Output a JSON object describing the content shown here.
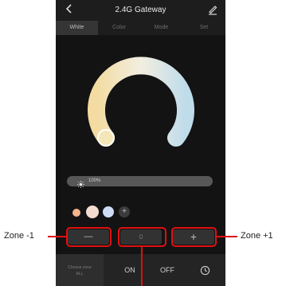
{
  "header": {
    "back_icon": "chevron-left-icon",
    "title": "2.4G Gateway",
    "edit_icon": "pencil-icon"
  },
  "tabs": [
    {
      "label": "White",
      "active": true
    },
    {
      "label": "Color",
      "active": false
    },
    {
      "label": "Mode",
      "active": false
    },
    {
      "label": "Set",
      "active": false
    }
  ],
  "wheel": {
    "gradient_start": "#f3dba1",
    "gradient_end": "#bfdcea",
    "selected_tone": "warm"
  },
  "brightness": {
    "value": "100%",
    "level": 1.0,
    "icon": "sun-icon"
  },
  "presets": {
    "swatches": [
      "#f4b48c",
      "#f4ddd0",
      "#cfdcf5"
    ],
    "add_icon": "plus-icon",
    "add_label": "+"
  },
  "zone_controls": {
    "minus_label": "—",
    "value": "0",
    "plus_label": "+"
  },
  "bottom_bar": {
    "choose_zone_line1": "Choose zone",
    "choose_zone_line2": "ALL",
    "on_label": "ON",
    "off_label": "OFF",
    "timer_icon": "clock-icon"
  },
  "annotations": {
    "zone_minus_label": "Zone -1",
    "zone_plus_label": "Zone +1",
    "highlight_color": "#e01010"
  }
}
